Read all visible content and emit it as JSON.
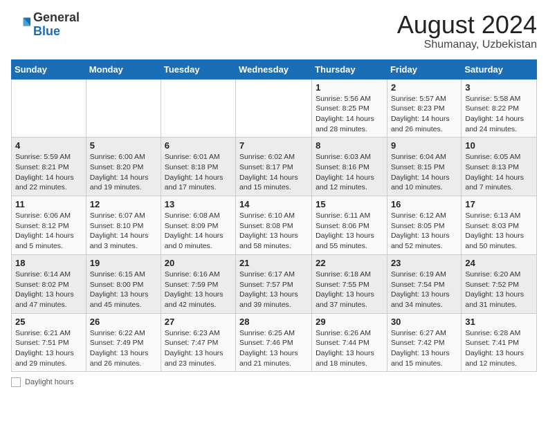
{
  "header": {
    "logo_general": "General",
    "logo_blue": "Blue",
    "month_year": "August 2024",
    "location": "Shumanay, Uzbekistan"
  },
  "days_of_week": [
    "Sunday",
    "Monday",
    "Tuesday",
    "Wednesday",
    "Thursday",
    "Friday",
    "Saturday"
  ],
  "weeks": [
    [
      {
        "num": "",
        "info": ""
      },
      {
        "num": "",
        "info": ""
      },
      {
        "num": "",
        "info": ""
      },
      {
        "num": "",
        "info": ""
      },
      {
        "num": "1",
        "info": "Sunrise: 5:56 AM\nSunset: 8:25 PM\nDaylight: 14 hours\nand 28 minutes."
      },
      {
        "num": "2",
        "info": "Sunrise: 5:57 AM\nSunset: 8:23 PM\nDaylight: 14 hours\nand 26 minutes."
      },
      {
        "num": "3",
        "info": "Sunrise: 5:58 AM\nSunset: 8:22 PM\nDaylight: 14 hours\nand 24 minutes."
      }
    ],
    [
      {
        "num": "4",
        "info": "Sunrise: 5:59 AM\nSunset: 8:21 PM\nDaylight: 14 hours\nand 22 minutes."
      },
      {
        "num": "5",
        "info": "Sunrise: 6:00 AM\nSunset: 8:20 PM\nDaylight: 14 hours\nand 19 minutes."
      },
      {
        "num": "6",
        "info": "Sunrise: 6:01 AM\nSunset: 8:18 PM\nDaylight: 14 hours\nand 17 minutes."
      },
      {
        "num": "7",
        "info": "Sunrise: 6:02 AM\nSunset: 8:17 PM\nDaylight: 14 hours\nand 15 minutes."
      },
      {
        "num": "8",
        "info": "Sunrise: 6:03 AM\nSunset: 8:16 PM\nDaylight: 14 hours\nand 12 minutes."
      },
      {
        "num": "9",
        "info": "Sunrise: 6:04 AM\nSunset: 8:15 PM\nDaylight: 14 hours\nand 10 minutes."
      },
      {
        "num": "10",
        "info": "Sunrise: 6:05 AM\nSunset: 8:13 PM\nDaylight: 14 hours\nand 7 minutes."
      }
    ],
    [
      {
        "num": "11",
        "info": "Sunrise: 6:06 AM\nSunset: 8:12 PM\nDaylight: 14 hours\nand 5 minutes."
      },
      {
        "num": "12",
        "info": "Sunrise: 6:07 AM\nSunset: 8:10 PM\nDaylight: 14 hours\nand 3 minutes."
      },
      {
        "num": "13",
        "info": "Sunrise: 6:08 AM\nSunset: 8:09 PM\nDaylight: 14 hours\nand 0 minutes."
      },
      {
        "num": "14",
        "info": "Sunrise: 6:10 AM\nSunset: 8:08 PM\nDaylight: 13 hours\nand 58 minutes."
      },
      {
        "num": "15",
        "info": "Sunrise: 6:11 AM\nSunset: 8:06 PM\nDaylight: 13 hours\nand 55 minutes."
      },
      {
        "num": "16",
        "info": "Sunrise: 6:12 AM\nSunset: 8:05 PM\nDaylight: 13 hours\nand 52 minutes."
      },
      {
        "num": "17",
        "info": "Sunrise: 6:13 AM\nSunset: 8:03 PM\nDaylight: 13 hours\nand 50 minutes."
      }
    ],
    [
      {
        "num": "18",
        "info": "Sunrise: 6:14 AM\nSunset: 8:02 PM\nDaylight: 13 hours\nand 47 minutes."
      },
      {
        "num": "19",
        "info": "Sunrise: 6:15 AM\nSunset: 8:00 PM\nDaylight: 13 hours\nand 45 minutes."
      },
      {
        "num": "20",
        "info": "Sunrise: 6:16 AM\nSunset: 7:59 PM\nDaylight: 13 hours\nand 42 minutes."
      },
      {
        "num": "21",
        "info": "Sunrise: 6:17 AM\nSunset: 7:57 PM\nDaylight: 13 hours\nand 39 minutes."
      },
      {
        "num": "22",
        "info": "Sunrise: 6:18 AM\nSunset: 7:55 PM\nDaylight: 13 hours\nand 37 minutes."
      },
      {
        "num": "23",
        "info": "Sunrise: 6:19 AM\nSunset: 7:54 PM\nDaylight: 13 hours\nand 34 minutes."
      },
      {
        "num": "24",
        "info": "Sunrise: 6:20 AM\nSunset: 7:52 PM\nDaylight: 13 hours\nand 31 minutes."
      }
    ],
    [
      {
        "num": "25",
        "info": "Sunrise: 6:21 AM\nSunset: 7:51 PM\nDaylight: 13 hours\nand 29 minutes."
      },
      {
        "num": "26",
        "info": "Sunrise: 6:22 AM\nSunset: 7:49 PM\nDaylight: 13 hours\nand 26 minutes."
      },
      {
        "num": "27",
        "info": "Sunrise: 6:23 AM\nSunset: 7:47 PM\nDaylight: 13 hours\nand 23 minutes."
      },
      {
        "num": "28",
        "info": "Sunrise: 6:25 AM\nSunset: 7:46 PM\nDaylight: 13 hours\nand 21 minutes."
      },
      {
        "num": "29",
        "info": "Sunrise: 6:26 AM\nSunset: 7:44 PM\nDaylight: 13 hours\nand 18 minutes."
      },
      {
        "num": "30",
        "info": "Sunrise: 6:27 AM\nSunset: 7:42 PM\nDaylight: 13 hours\nand 15 minutes."
      },
      {
        "num": "31",
        "info": "Sunrise: 6:28 AM\nSunset: 7:41 PM\nDaylight: 13 hours\nand 12 minutes."
      }
    ]
  ],
  "footer": {
    "daylight_label": "Daylight hours"
  }
}
